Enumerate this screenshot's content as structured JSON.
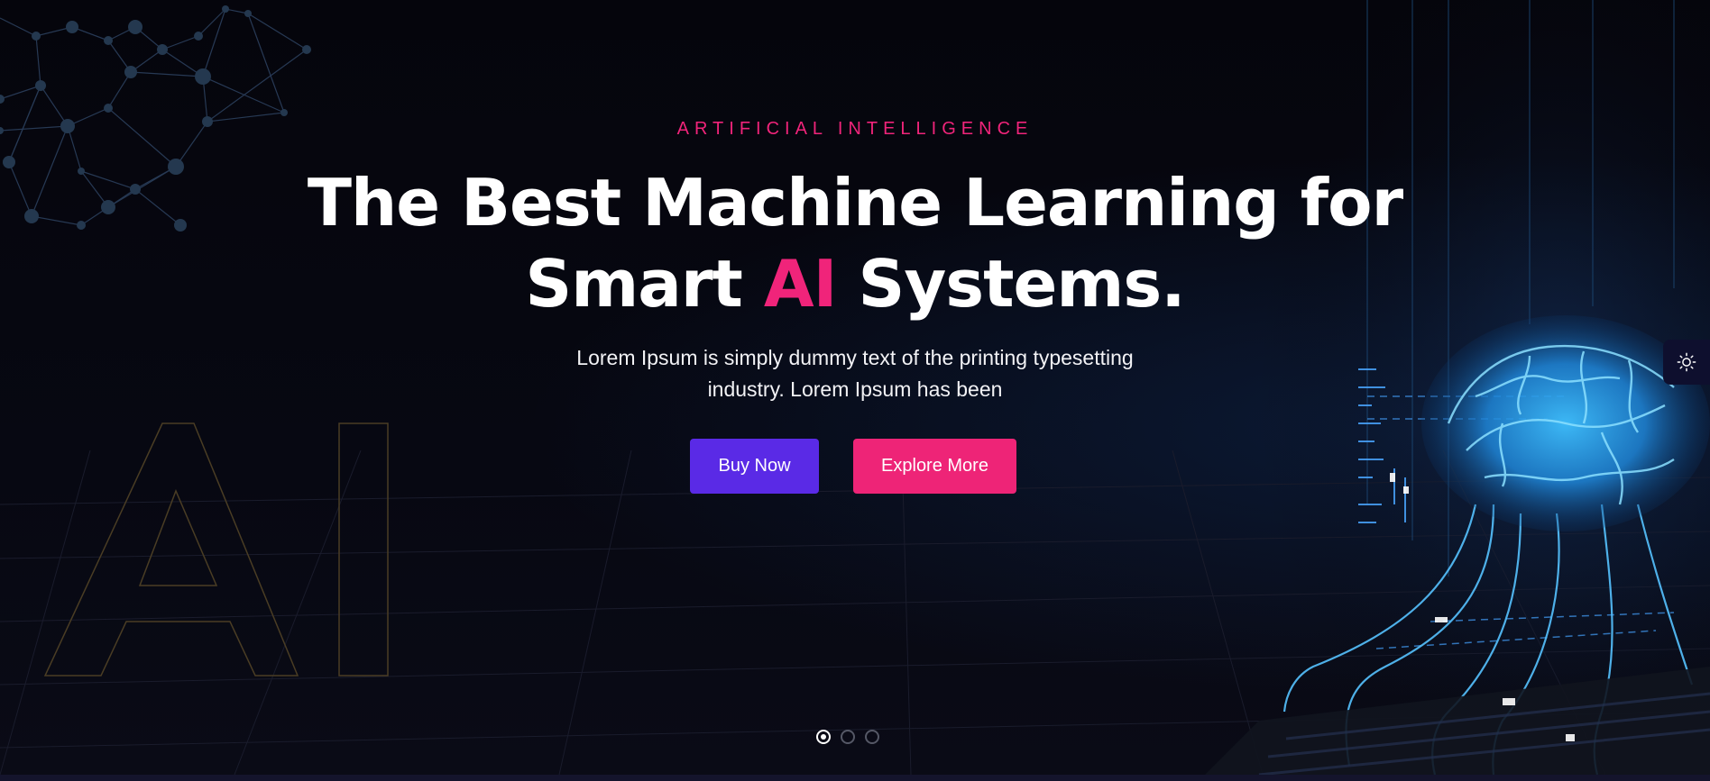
{
  "hero": {
    "eyebrow": "ARTIFICIAL INTELLIGENCE",
    "headline_line1": "The Best Machine Learning for",
    "headline_pre": "Smart ",
    "headline_accent": "AI",
    "headline_post": " Systems.",
    "subtitle_line1": "Lorem Ipsum is simply dummy text of the printing typesetting",
    "subtitle_line2": "industry. Lorem Ipsum has been",
    "background_outline_text": "AI"
  },
  "buttons": {
    "buy_label": "Buy Now",
    "explore_label": "Explore More"
  },
  "slider": {
    "slide_count": 3,
    "active_index": 0
  },
  "icons": {
    "theme_toggle": "sun-icon",
    "background": [
      "network-graph",
      "brain-circuit"
    ]
  },
  "colors": {
    "background": "#05050b",
    "accent_pink": "#f0247a",
    "button_purple": "#5a2ae6",
    "button_pink": "#ee2477",
    "glow_blue": "#29a8ff"
  }
}
